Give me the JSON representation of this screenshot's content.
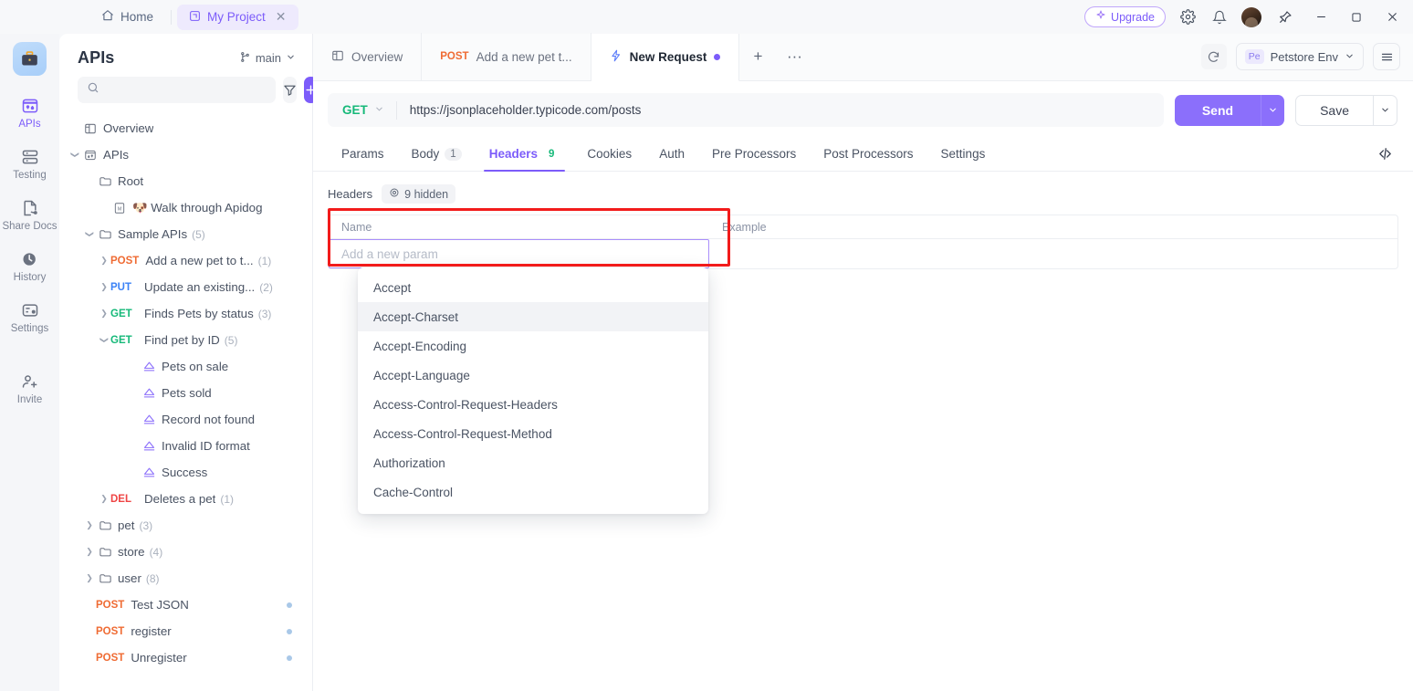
{
  "titlebar": {
    "home_label": "Home",
    "project_tab": "My Project",
    "close_glyph": "✕",
    "upgrade_label": "Upgrade"
  },
  "rail": {
    "items": [
      {
        "label": "APIs",
        "icon": "apis-icon",
        "active": true
      },
      {
        "label": "Testing",
        "icon": "testing-icon",
        "active": false
      },
      {
        "label": "Share Docs",
        "icon": "share-docs-icon",
        "active": false
      },
      {
        "label": "History",
        "icon": "history-icon",
        "active": false
      },
      {
        "label": "Settings",
        "icon": "settings-icon",
        "active": false
      },
      {
        "label": "Invite",
        "icon": "invite-icon",
        "active": false
      }
    ]
  },
  "sidebar": {
    "title": "APIs",
    "branch": "main",
    "search_placeholder": "",
    "search_value": "",
    "tree": [
      {
        "label": "Overview",
        "icon": "overview-icon",
        "indent": 0,
        "caret": "",
        "type": "nav"
      },
      {
        "label": "APIs",
        "icon": "apis-small-icon",
        "indent": 0,
        "caret": "▾",
        "type": "nav"
      },
      {
        "label": "Root",
        "icon": "folder-icon",
        "indent": 1,
        "caret": "",
        "type": "folder"
      },
      {
        "label": "🐶 Walk through Apidog",
        "icon": "markdown-icon",
        "indent": 2,
        "caret": "",
        "type": "doc"
      },
      {
        "label": "Sample APIs",
        "icon": "folder-icon",
        "indent": 1,
        "caret": "⌄",
        "count": "(5)",
        "type": "folder"
      },
      {
        "label": "Add a new pet to t...",
        "method": "POST",
        "indent": 2,
        "caret": "›",
        "count": "(1)",
        "type": "api"
      },
      {
        "label": "Update an existing...",
        "method": "PUT",
        "indent": 2,
        "caret": "›",
        "count": "(2)",
        "type": "api"
      },
      {
        "label": "Finds Pets by status",
        "method": "GET",
        "indent": 2,
        "caret": "›",
        "count": "(3)",
        "type": "api"
      },
      {
        "label": "Find pet by ID",
        "method": "GET",
        "indent": 2,
        "caret": "⌄",
        "count": "(5)",
        "type": "api"
      },
      {
        "label": "Pets on sale",
        "icon": "case-icon",
        "indent": 4,
        "caret": "",
        "type": "case"
      },
      {
        "label": "Pets sold",
        "icon": "case-icon",
        "indent": 4,
        "caret": "",
        "type": "case"
      },
      {
        "label": "Record not found",
        "icon": "case-icon",
        "indent": 4,
        "caret": "",
        "type": "case"
      },
      {
        "label": "Invalid ID format",
        "icon": "case-icon",
        "indent": 4,
        "caret": "",
        "type": "case"
      },
      {
        "label": "Success",
        "icon": "case-icon",
        "indent": 4,
        "caret": "",
        "type": "case"
      },
      {
        "label": "Deletes a pet",
        "method": "DEL",
        "indent": 2,
        "caret": "›",
        "count": "(1)",
        "type": "api"
      },
      {
        "label": "pet",
        "icon": "folder-icon",
        "indent": 1,
        "caret": "›",
        "count": "(3)",
        "type": "folder"
      },
      {
        "label": "store",
        "icon": "folder-icon",
        "indent": 1,
        "caret": "›",
        "count": "(4)",
        "type": "folder"
      },
      {
        "label": "user",
        "icon": "folder-icon",
        "indent": 1,
        "caret": "›",
        "count": "(8)",
        "type": "folder"
      },
      {
        "label": "Test JSON",
        "method": "POST",
        "indent": 1,
        "caret": "",
        "type": "api",
        "dot": true
      },
      {
        "label": "register",
        "method": "POST",
        "indent": 1,
        "caret": "",
        "type": "api",
        "dot": true
      },
      {
        "label": "Unregister",
        "method": "POST",
        "indent": 1,
        "caret": "",
        "type": "api",
        "dot": true
      }
    ]
  },
  "request_tabs": [
    {
      "label": "Overview",
      "icon": "overview-icon",
      "active": false
    },
    {
      "label": "Add a new pet t...",
      "method": "POST",
      "active": false
    },
    {
      "label": "New Request",
      "icon": "lightning-icon",
      "active": true,
      "dirty": true
    }
  ],
  "tabbar_actions": {
    "add_label": "+",
    "more_label": "···",
    "env_badge": "Pe",
    "env_name": "Petstore Env"
  },
  "url_bar": {
    "method": "GET",
    "url": "https://jsonplaceholder.typicode.com/posts",
    "send_label": "Send",
    "save_label": "Save"
  },
  "section_tabs": [
    {
      "label": "Params",
      "badge": "",
      "active": false
    },
    {
      "label": "Body",
      "badge": "1",
      "badge_style": "gray",
      "active": false
    },
    {
      "label": "Headers",
      "badge": "9",
      "badge_style": "green",
      "active": true
    },
    {
      "label": "Cookies",
      "badge": "",
      "active": false
    },
    {
      "label": "Auth",
      "badge": "",
      "active": false
    },
    {
      "label": "Pre Processors",
      "badge": "",
      "active": false
    },
    {
      "label": "Post Processors",
      "badge": "",
      "active": false
    },
    {
      "label": "Settings",
      "badge": "",
      "active": false
    }
  ],
  "headers_panel": {
    "label": "Headers",
    "hidden_chip": "9 hidden",
    "col_name": "Name",
    "col_example": "Example",
    "new_param_placeholder": "Add a new param",
    "new_param_value": ""
  },
  "autocomplete": {
    "options": [
      {
        "label": "Accept",
        "highlighted": false
      },
      {
        "label": "Accept-Charset",
        "highlighted": true
      },
      {
        "label": "Accept-Encoding",
        "highlighted": false
      },
      {
        "label": "Accept-Language",
        "highlighted": false
      },
      {
        "label": "Access-Control-Request-Headers",
        "highlighted": false
      },
      {
        "label": "Access-Control-Request-Method",
        "highlighted": false
      },
      {
        "label": "Authorization",
        "highlighted": false
      },
      {
        "label": "Cache-Control",
        "highlighted": false
      }
    ]
  },
  "colors": {
    "accent": "#7c5cfa",
    "send": "#8b6ffb",
    "get": "#16b979",
    "post": "#ef6b33",
    "put": "#3b82f6",
    "del": "#ef4444",
    "annotation": "#f21b1b"
  }
}
